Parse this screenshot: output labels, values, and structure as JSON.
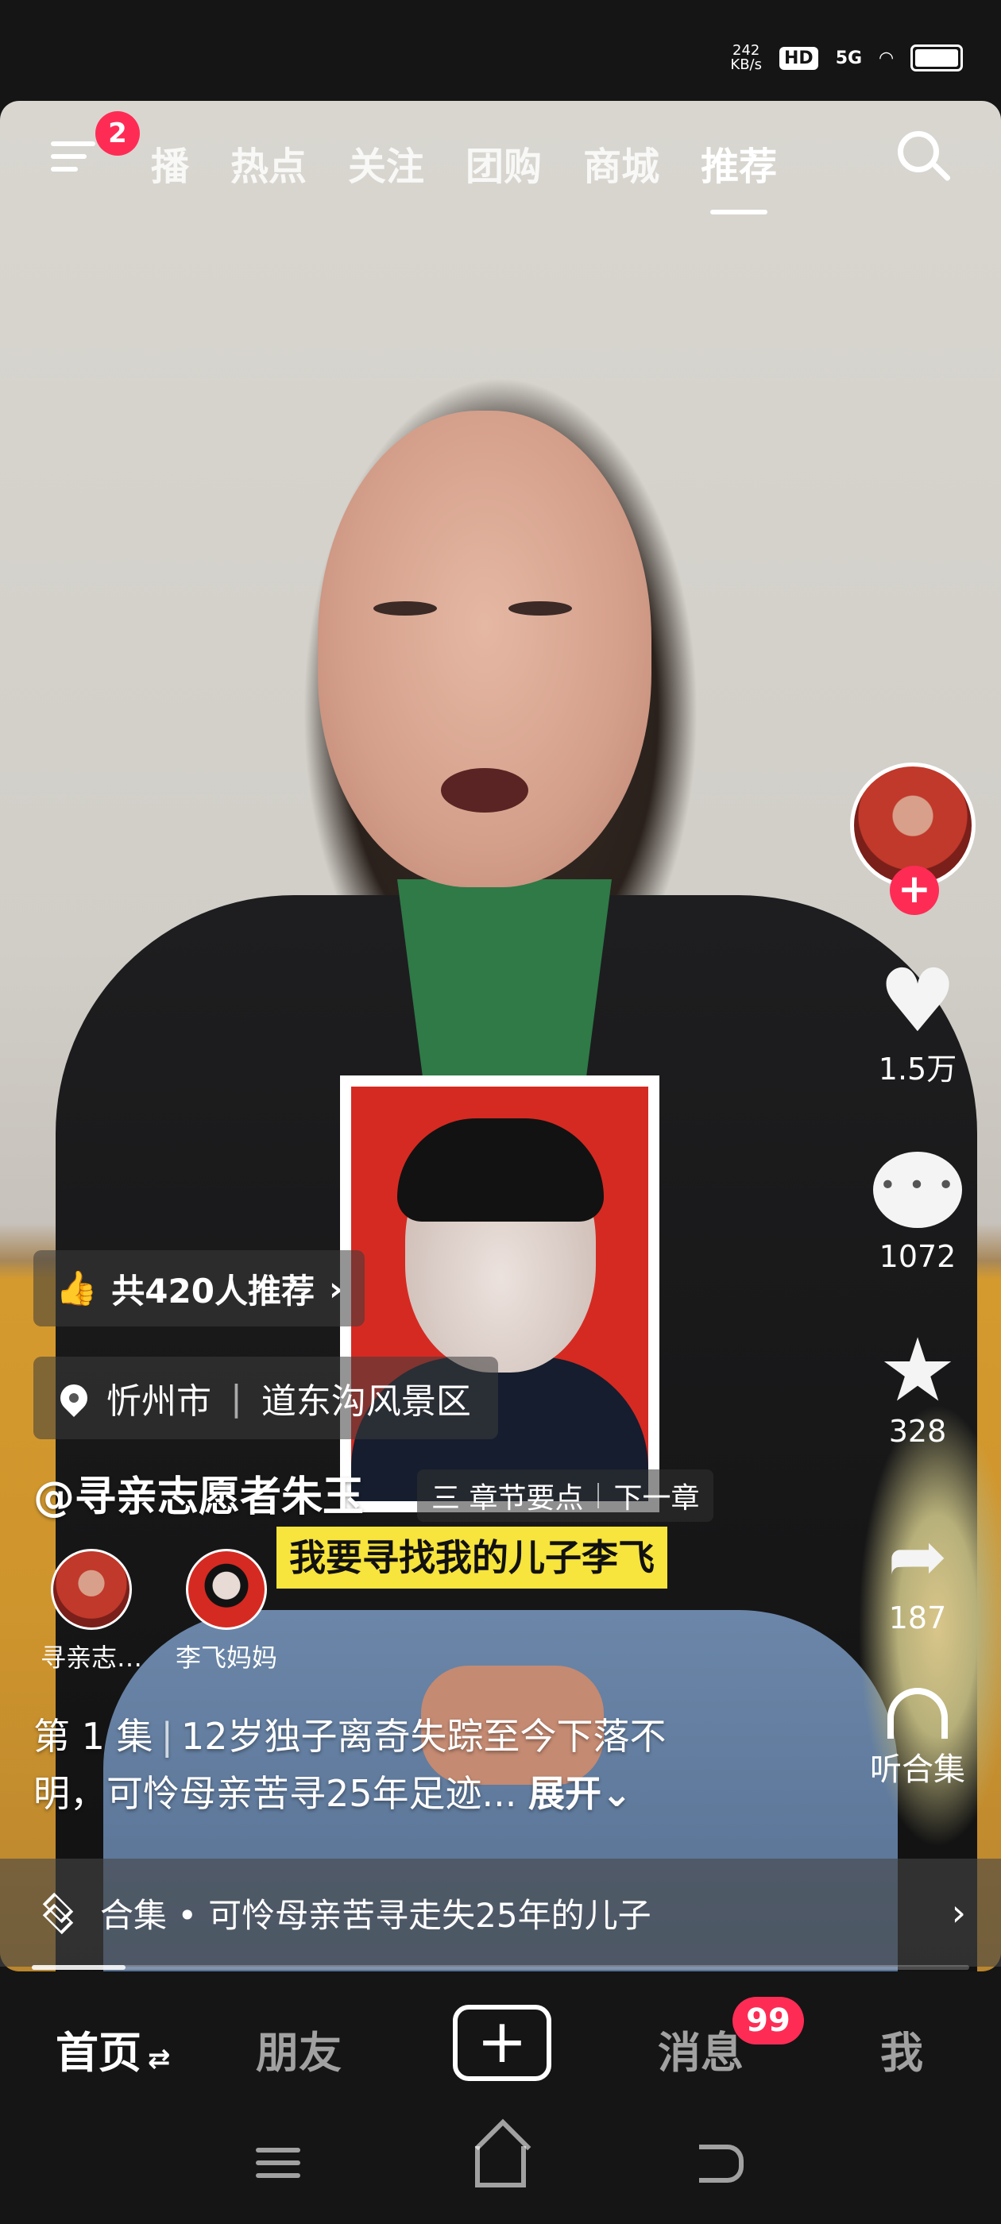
{
  "status_bar": {
    "net_speed": "242",
    "net_unit": "KB/s",
    "hd": "HD",
    "network": "5G"
  },
  "top_nav": {
    "menu_badge": "2",
    "tabs": [
      "播",
      "热点",
      "关注",
      "团购",
      "商城",
      "推荐"
    ],
    "active_tab": "推荐"
  },
  "video": {
    "subtitle": "我要寻找我的儿子李飞",
    "photo_desc": "boy portrait on red background"
  },
  "right_rail": {
    "likes": "1.5万",
    "comments": "1072",
    "favorites": "328",
    "shares": "187",
    "listen_label": "听合集"
  },
  "info": {
    "recommend_label": "共420人推荐",
    "location_city": "忻州市",
    "location_place": "道东沟风景区",
    "author": "@寻亲志愿者朱玉",
    "chapter_points": "三 章节要点",
    "next_chapter": "下一章",
    "coauthors": [
      {
        "name": "寻亲志…"
      },
      {
        "name": "李飞妈妈"
      }
    ],
    "episode": "第 1 集",
    "description": "12岁独子离奇失踪至今下落不明，可怜母亲苦寻25年足迹...",
    "expand": "展开",
    "collection_dot": "合集 •",
    "collection_title": "可怜母亲苦寻走失25年的儿子",
    "progress": 0.1
  },
  "bottom_nav": {
    "home": "首页",
    "home_swap": "⇄",
    "friends": "朋友",
    "plus": "+",
    "messages": "消息",
    "messages_badge": "99",
    "me": "我"
  }
}
